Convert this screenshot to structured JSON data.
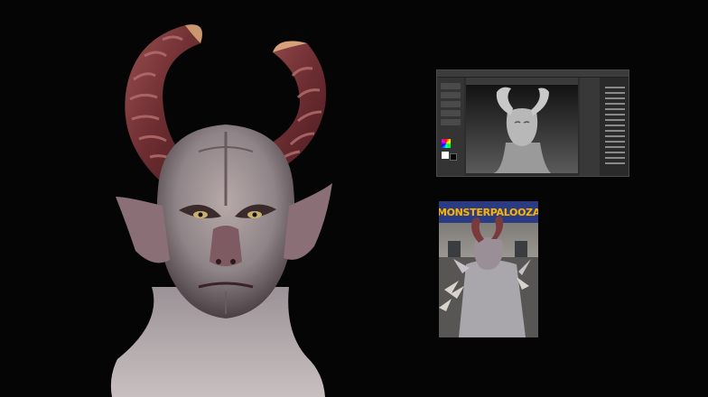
{
  "photo": {
    "banner_text": "MONSTERPALOOZA"
  },
  "colors": {
    "background": "#050505",
    "horn": "#7a3a3c",
    "skin": "#a49aa0",
    "banner_blue": "#2a3b86",
    "banner_text": "#f2b514"
  },
  "icons": {
    "bust": "demon-bust-image",
    "zbrush": "zbrush-screenshot-image",
    "photo": "costume-photo-image"
  }
}
